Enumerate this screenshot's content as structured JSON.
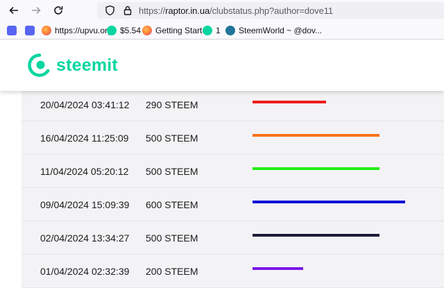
{
  "browser": {
    "url_prefix": "https://",
    "url_host": "raptor.in.ua",
    "url_path": "/clubstatus.php?author=dove11",
    "bookmarks": [
      {
        "label": "",
        "icon": "discord-icon",
        "color": "#5865f2"
      },
      {
        "label": "",
        "icon": "discord-icon",
        "color": "#5865f2"
      },
      {
        "label": "https://upvu.org/",
        "icon": "firefox-icon",
        "color": "#ff7139"
      },
      {
        "label": "$5.54",
        "icon": "steemit-icon",
        "color": "#07d6a0"
      },
      {
        "label": "Getting Started",
        "icon": "firefox-icon",
        "color": "#ff7139"
      },
      {
        "label": "1",
        "icon": "steemit-icon",
        "color": "#07d6a0"
      },
      {
        "label": "SteemWorld ~ @dov...",
        "icon": "wordpress-icon",
        "color": "#21759b"
      }
    ]
  },
  "header": {
    "logo_text": "steemit",
    "brand_color": "#07d6a0"
  },
  "rows": [
    {
      "date": "20/04/2024 03:41:12",
      "amount": "290 STEEM",
      "bar_color": "#ee1c1c",
      "bar_value": 290
    },
    {
      "date": "16/04/2024 11:25:09",
      "amount": "500 STEEM",
      "bar_color": "#f7731c",
      "bar_value": 500
    },
    {
      "date": "11/04/2024 05:20:12",
      "amount": "500 STEEM",
      "bar_color": "#22ee11",
      "bar_value": 500
    },
    {
      "date": "09/04/2024 15:09:39",
      "amount": "600 STEEM",
      "bar_color": "#0a0ad6",
      "bar_value": 600
    },
    {
      "date": "02/04/2024 13:34:27",
      "amount": "500 STEEM",
      "bar_color": "#1a1a38",
      "bar_value": 500
    },
    {
      "date": "01/04/2024 02:32:39",
      "amount": "200 STEEM",
      "bar_color": "#7a16ea",
      "bar_value": 200
    }
  ]
}
